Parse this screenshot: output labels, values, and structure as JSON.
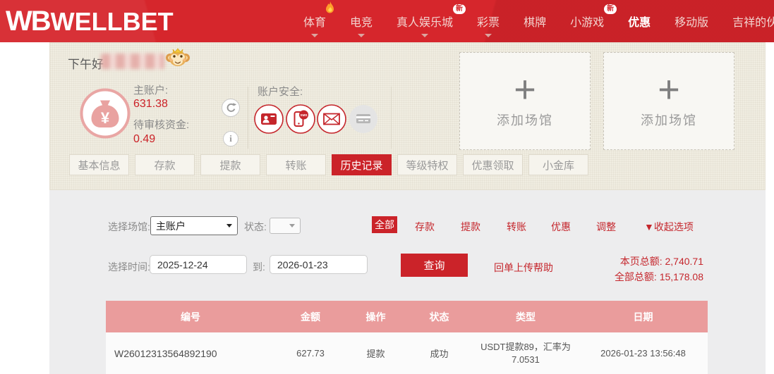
{
  "navbar": {
    "logo_mark": "WB",
    "logo_text": "WELLBET",
    "items": [
      {
        "label": "体育"
      },
      {
        "label": "电竞"
      },
      {
        "label": "真人娱乐城",
        "badge": "新"
      },
      {
        "label": "彩票"
      },
      {
        "label": "棋牌"
      },
      {
        "label": "小游戏",
        "badge": "新"
      },
      {
        "label": "优惠"
      },
      {
        "label": "移动版"
      },
      {
        "label": "吉祥的伙"
      }
    ],
    "active_item": "优惠"
  },
  "account": {
    "greeting": "下午好",
    "username_hidden": true,
    "main_label": "主账户:",
    "main_value": "631.38",
    "pending_label": "待审核资金:",
    "pending_value": "0.49",
    "security_label": "账户安全:",
    "add_plus": "+",
    "add_label": "添加场馆",
    "tabs": [
      "基本信息",
      "存款",
      "提款",
      "转账",
      "历史记录",
      "等级特权",
      "优惠领取",
      "小金库"
    ],
    "active_tab": "历史记录"
  },
  "filters": {
    "venue_label": "选择场馆:",
    "venue_value": "主账户",
    "status_label": "状态:",
    "status_value": "",
    "types": [
      "全部",
      "存款",
      "提款",
      "转账",
      "优惠",
      "调整"
    ],
    "active_type": "全部",
    "collapse": "▼收起选项",
    "time_label": "选择时间:",
    "date_from": "2025-12-24",
    "to_label": "到:",
    "date_to": "2026-01-23",
    "query": "查询",
    "help": "回单上传帮助",
    "page_total": "本页总额: 2,740.71",
    "all_total": "全部总额: 15,178.08"
  },
  "table": {
    "headers": [
      "编号",
      "金额",
      "操作",
      "状态",
      "类型",
      "日期"
    ],
    "rows": [
      {
        "id": "W26012313564892190",
        "amount": "627.73",
        "operation": "提款",
        "status": "成功",
        "type_line1": "USDT提款89，汇率为",
        "type_line2": "7.0531",
        "date": "2026-01-23 13:56:48"
      }
    ]
  },
  "icons": {
    "yuan": "¥",
    "info": "i",
    "sms_label": "SMS"
  },
  "colors": {
    "navbar_red": "#d6262c",
    "accent_red": "#c5262c",
    "active_btn_red": "#cb2329",
    "table_header_pink": "#ea9c9c",
    "panel_beige": "#f0ede1",
    "panel_gray": "#ededee"
  }
}
